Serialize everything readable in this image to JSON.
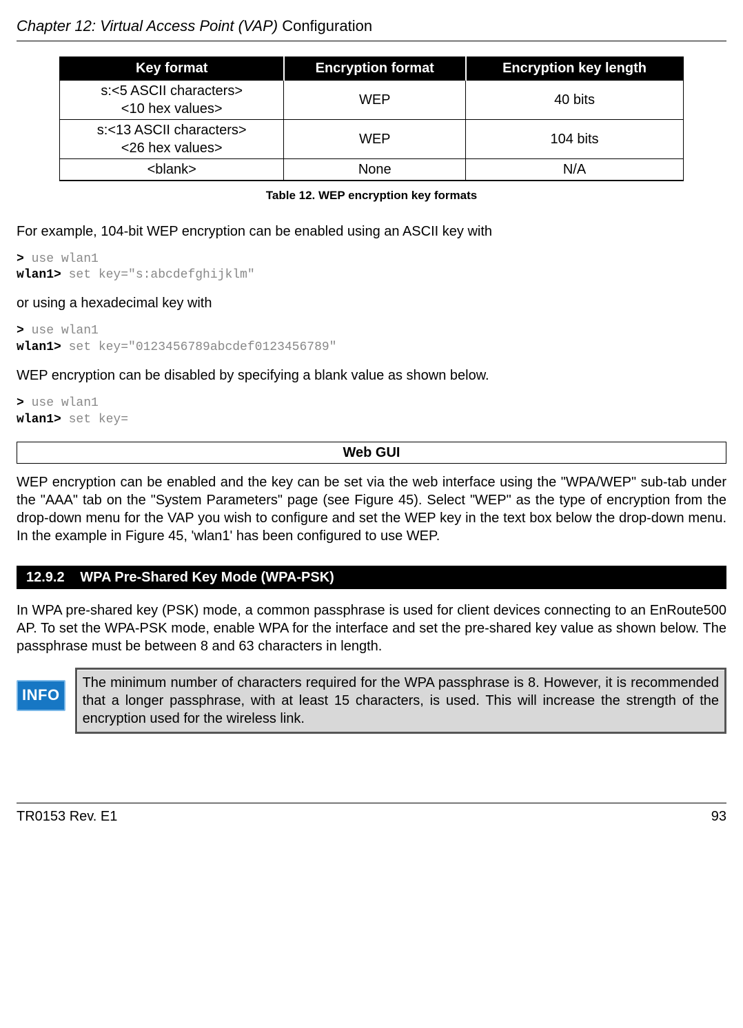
{
  "header": {
    "chapter_italic": "Chapter 12: Virtual Access Point (VAP)",
    "chapter_plain": " Configuration"
  },
  "table": {
    "headers": [
      "Key format",
      "Encryption format",
      "Encryption key length"
    ],
    "rows": [
      {
        "key_format_l1": "s:<5 ASCII characters>",
        "key_format_l2": "<10 hex values>",
        "enc_format": "WEP",
        "key_len": "40 bits"
      },
      {
        "key_format_l1": "s:<13 ASCII characters>",
        "key_format_l2": "<26 hex values>",
        "enc_format": "WEP",
        "key_len": "104 bits"
      },
      {
        "key_format_l1": "<blank>",
        "key_format_l2": "",
        "enc_format": "None",
        "key_len": "N/A"
      }
    ],
    "caption": "Table 12. WEP encryption key formats"
  },
  "body": {
    "p1": "For example, 104-bit WEP encryption can be enabled using an ASCII key with",
    "code1_prompt1": ">",
    "code1_cmd1": " use wlan1",
    "code1_prompt2": "wlan1>",
    "code1_cmd2": " set key=\"s:abcdefghijklm\"",
    "p2": "or using a hexadecimal key with",
    "code2_prompt1": ">",
    "code2_cmd1": " use wlan1",
    "code2_prompt2": "wlan1>",
    "code2_cmd2": " set key=\"0123456789abcdef0123456789\"",
    "p3": "WEP encryption can be disabled by specifying a blank value as shown below.",
    "code3_prompt1": ">",
    "code3_cmd1": " use wlan1",
    "code3_prompt2": "wlan1>",
    "code3_cmd2": " set key=",
    "webgui": "Web GUI",
    "p4": "WEP encryption can be enabled and the key can be set via the web interface using the \"WPA/WEP\" sub-tab under the \"AAA\" tab on the \"System Parameters\" page (see Figure 45). Select \"WEP\" as the type of encryption from the drop-down menu for the VAP you wish to configure and set the WEP key in the text box below the drop-down menu. In the example in Figure 45, 'wlan1' has been configured to use WEP."
  },
  "section": {
    "num": "12.9.2",
    "title": "WPA Pre-Shared Key Mode (WPA-PSK)",
    "p1": "In WPA pre-shared key (PSK) mode, a common passphrase is used for client devices connecting to an EnRoute500 AP. To set the WPA-PSK mode, enable WPA for the interface and set the pre-shared key value as shown below. The passphrase must be between 8 and 63 characters in length."
  },
  "info": {
    "badge": "INFO",
    "text": "The minimum number of characters required for the WPA passphrase is 8. However, it is recommended that a longer passphrase, with at least 15 characters, is used. This will increase the strength of the encryption used for the wireless link."
  },
  "footer": {
    "left": "TR0153 Rev. E1",
    "right": "93"
  }
}
